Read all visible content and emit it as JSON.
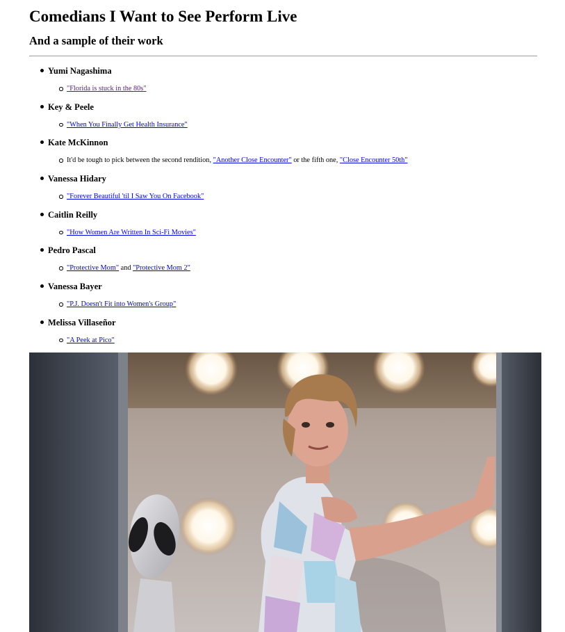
{
  "header": {
    "title": "Comedians I Want to See Perform Live",
    "subtitle": "And a sample of their work"
  },
  "comedians": [
    {
      "name": "Yumi Nagashima",
      "parts": [
        {
          "text": "\"Florida is stuck in the 80s\"",
          "link": true,
          "visited": true
        }
      ]
    },
    {
      "name": "Key & Peele",
      "parts": [
        {
          "text": "\"When You Finally Get Health Insurance\"",
          "link": true
        }
      ]
    },
    {
      "name": "Kate McKinnon",
      "parts": [
        {
          "text": "It'd be tough to pick between the second rendition, ",
          "link": false
        },
        {
          "text": "\"Another Close Encounter\"",
          "link": true
        },
        {
          "text": " or the fifth one, ",
          "link": false
        },
        {
          "text": "\"Close Encounter 50th\"",
          "link": true
        }
      ]
    },
    {
      "name": "Vanessa Hidary",
      "parts": [
        {
          "text": "\"Forever Beautiful 'til I Saw You On Facebook\"",
          "link": true
        }
      ]
    },
    {
      "name": "Caitlin Reilly",
      "parts": [
        {
          "text": "\"How Women Are Written In Sci-Fi Movies\"",
          "link": true
        }
      ]
    },
    {
      "name": "Pedro Pascal",
      "parts": [
        {
          "text": "\"Protective Mom\"",
          "link": true
        },
        {
          "text": " and ",
          "link": false
        },
        {
          "text": "\"Protective Mom 2\"",
          "link": true
        }
      ]
    },
    {
      "name": "Vanessa Bayer",
      "parts": [
        {
          "text": "\"P.J. Doesn't Fit into Women's Group\"",
          "link": true
        }
      ]
    },
    {
      "name": "Melissa Villaseñor",
      "parts": [
        {
          "text": "\"A Peek at Pico\"",
          "link": true
        }
      ]
    }
  ],
  "colors": {
    "link": "#0000ee",
    "visited_link": "#551a8b",
    "rule": "#9a9a9a"
  },
  "image": {
    "semantic": "tv-sketch-still-woman-with-alien"
  }
}
